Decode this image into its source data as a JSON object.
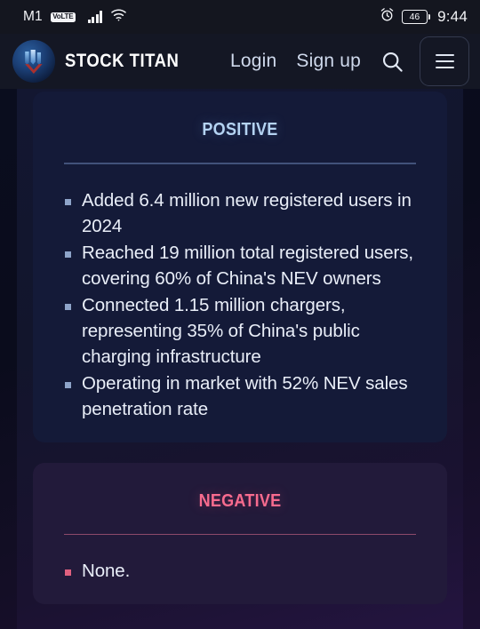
{
  "status_bar": {
    "carrier": "M1",
    "volte_label": "VoLTE",
    "signal_icon": "signal-bars-icon",
    "wifi_icon": "wifi-icon",
    "alarm_icon": "alarm-clock-icon",
    "battery_level": "46",
    "time": "9:44"
  },
  "header": {
    "logo_icon": "stock-titan-logo-icon",
    "brand_name": "STOCK TITAN",
    "login_label": "Login",
    "signup_label": "Sign up",
    "search_icon": "search-icon",
    "menu_icon": "hamburger-menu-icon"
  },
  "cards": [
    {
      "id": "positive",
      "heading": "Positive",
      "accent_color": "#b4d3f2",
      "background_color": "#141a38",
      "bullets": [
        "Added 6.4 million new registered users in 2024",
        "Reached 19 million total registered users, covering 60% of China's NEV owners",
        "Connected 1.15 million chargers, representing 35% of China's public charging infrastructure",
        "Operating in market with 52% NEV sales penetration rate"
      ]
    },
    {
      "id": "negative",
      "heading": "Negative",
      "accent_color": "#f76b8e",
      "background_color": "#221a3a",
      "bullets": [
        "None."
      ]
    }
  ]
}
